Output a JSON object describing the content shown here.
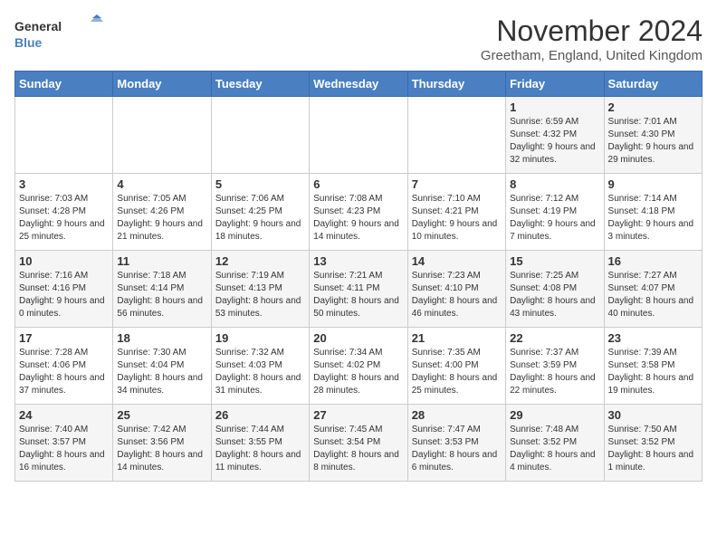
{
  "logo": {
    "line1": "General",
    "line2": "Blue"
  },
  "title": "November 2024",
  "location": "Greetham, England, United Kingdom",
  "days_of_week": [
    "Sunday",
    "Monday",
    "Tuesday",
    "Wednesday",
    "Thursday",
    "Friday",
    "Saturday"
  ],
  "weeks": [
    [
      {
        "day": "",
        "info": ""
      },
      {
        "day": "",
        "info": ""
      },
      {
        "day": "",
        "info": ""
      },
      {
        "day": "",
        "info": ""
      },
      {
        "day": "",
        "info": ""
      },
      {
        "day": "1",
        "info": "Sunrise: 6:59 AM\nSunset: 4:32 PM\nDaylight: 9 hours and 32 minutes."
      },
      {
        "day": "2",
        "info": "Sunrise: 7:01 AM\nSunset: 4:30 PM\nDaylight: 9 hours and 29 minutes."
      }
    ],
    [
      {
        "day": "3",
        "info": "Sunrise: 7:03 AM\nSunset: 4:28 PM\nDaylight: 9 hours and 25 minutes."
      },
      {
        "day": "4",
        "info": "Sunrise: 7:05 AM\nSunset: 4:26 PM\nDaylight: 9 hours and 21 minutes."
      },
      {
        "day": "5",
        "info": "Sunrise: 7:06 AM\nSunset: 4:25 PM\nDaylight: 9 hours and 18 minutes."
      },
      {
        "day": "6",
        "info": "Sunrise: 7:08 AM\nSunset: 4:23 PM\nDaylight: 9 hours and 14 minutes."
      },
      {
        "day": "7",
        "info": "Sunrise: 7:10 AM\nSunset: 4:21 PM\nDaylight: 9 hours and 10 minutes."
      },
      {
        "day": "8",
        "info": "Sunrise: 7:12 AM\nSunset: 4:19 PM\nDaylight: 9 hours and 7 minutes."
      },
      {
        "day": "9",
        "info": "Sunrise: 7:14 AM\nSunset: 4:18 PM\nDaylight: 9 hours and 3 minutes."
      }
    ],
    [
      {
        "day": "10",
        "info": "Sunrise: 7:16 AM\nSunset: 4:16 PM\nDaylight: 9 hours and 0 minutes."
      },
      {
        "day": "11",
        "info": "Sunrise: 7:18 AM\nSunset: 4:14 PM\nDaylight: 8 hours and 56 minutes."
      },
      {
        "day": "12",
        "info": "Sunrise: 7:19 AM\nSunset: 4:13 PM\nDaylight: 8 hours and 53 minutes."
      },
      {
        "day": "13",
        "info": "Sunrise: 7:21 AM\nSunset: 4:11 PM\nDaylight: 8 hours and 50 minutes."
      },
      {
        "day": "14",
        "info": "Sunrise: 7:23 AM\nSunset: 4:10 PM\nDaylight: 8 hours and 46 minutes."
      },
      {
        "day": "15",
        "info": "Sunrise: 7:25 AM\nSunset: 4:08 PM\nDaylight: 8 hours and 43 minutes."
      },
      {
        "day": "16",
        "info": "Sunrise: 7:27 AM\nSunset: 4:07 PM\nDaylight: 8 hours and 40 minutes."
      }
    ],
    [
      {
        "day": "17",
        "info": "Sunrise: 7:28 AM\nSunset: 4:06 PM\nDaylight: 8 hours and 37 minutes."
      },
      {
        "day": "18",
        "info": "Sunrise: 7:30 AM\nSunset: 4:04 PM\nDaylight: 8 hours and 34 minutes."
      },
      {
        "day": "19",
        "info": "Sunrise: 7:32 AM\nSunset: 4:03 PM\nDaylight: 8 hours and 31 minutes."
      },
      {
        "day": "20",
        "info": "Sunrise: 7:34 AM\nSunset: 4:02 PM\nDaylight: 8 hours and 28 minutes."
      },
      {
        "day": "21",
        "info": "Sunrise: 7:35 AM\nSunset: 4:00 PM\nDaylight: 8 hours and 25 minutes."
      },
      {
        "day": "22",
        "info": "Sunrise: 7:37 AM\nSunset: 3:59 PM\nDaylight: 8 hours and 22 minutes."
      },
      {
        "day": "23",
        "info": "Sunrise: 7:39 AM\nSunset: 3:58 PM\nDaylight: 8 hours and 19 minutes."
      }
    ],
    [
      {
        "day": "24",
        "info": "Sunrise: 7:40 AM\nSunset: 3:57 PM\nDaylight: 8 hours and 16 minutes."
      },
      {
        "day": "25",
        "info": "Sunrise: 7:42 AM\nSunset: 3:56 PM\nDaylight: 8 hours and 14 minutes."
      },
      {
        "day": "26",
        "info": "Sunrise: 7:44 AM\nSunset: 3:55 PM\nDaylight: 8 hours and 11 minutes."
      },
      {
        "day": "27",
        "info": "Sunrise: 7:45 AM\nSunset: 3:54 PM\nDaylight: 8 hours and 8 minutes."
      },
      {
        "day": "28",
        "info": "Sunrise: 7:47 AM\nSunset: 3:53 PM\nDaylight: 8 hours and 6 minutes."
      },
      {
        "day": "29",
        "info": "Sunrise: 7:48 AM\nSunset: 3:52 PM\nDaylight: 8 hours and 4 minutes."
      },
      {
        "day": "30",
        "info": "Sunrise: 7:50 AM\nSunset: 3:52 PM\nDaylight: 8 hours and 1 minute."
      }
    ]
  ]
}
